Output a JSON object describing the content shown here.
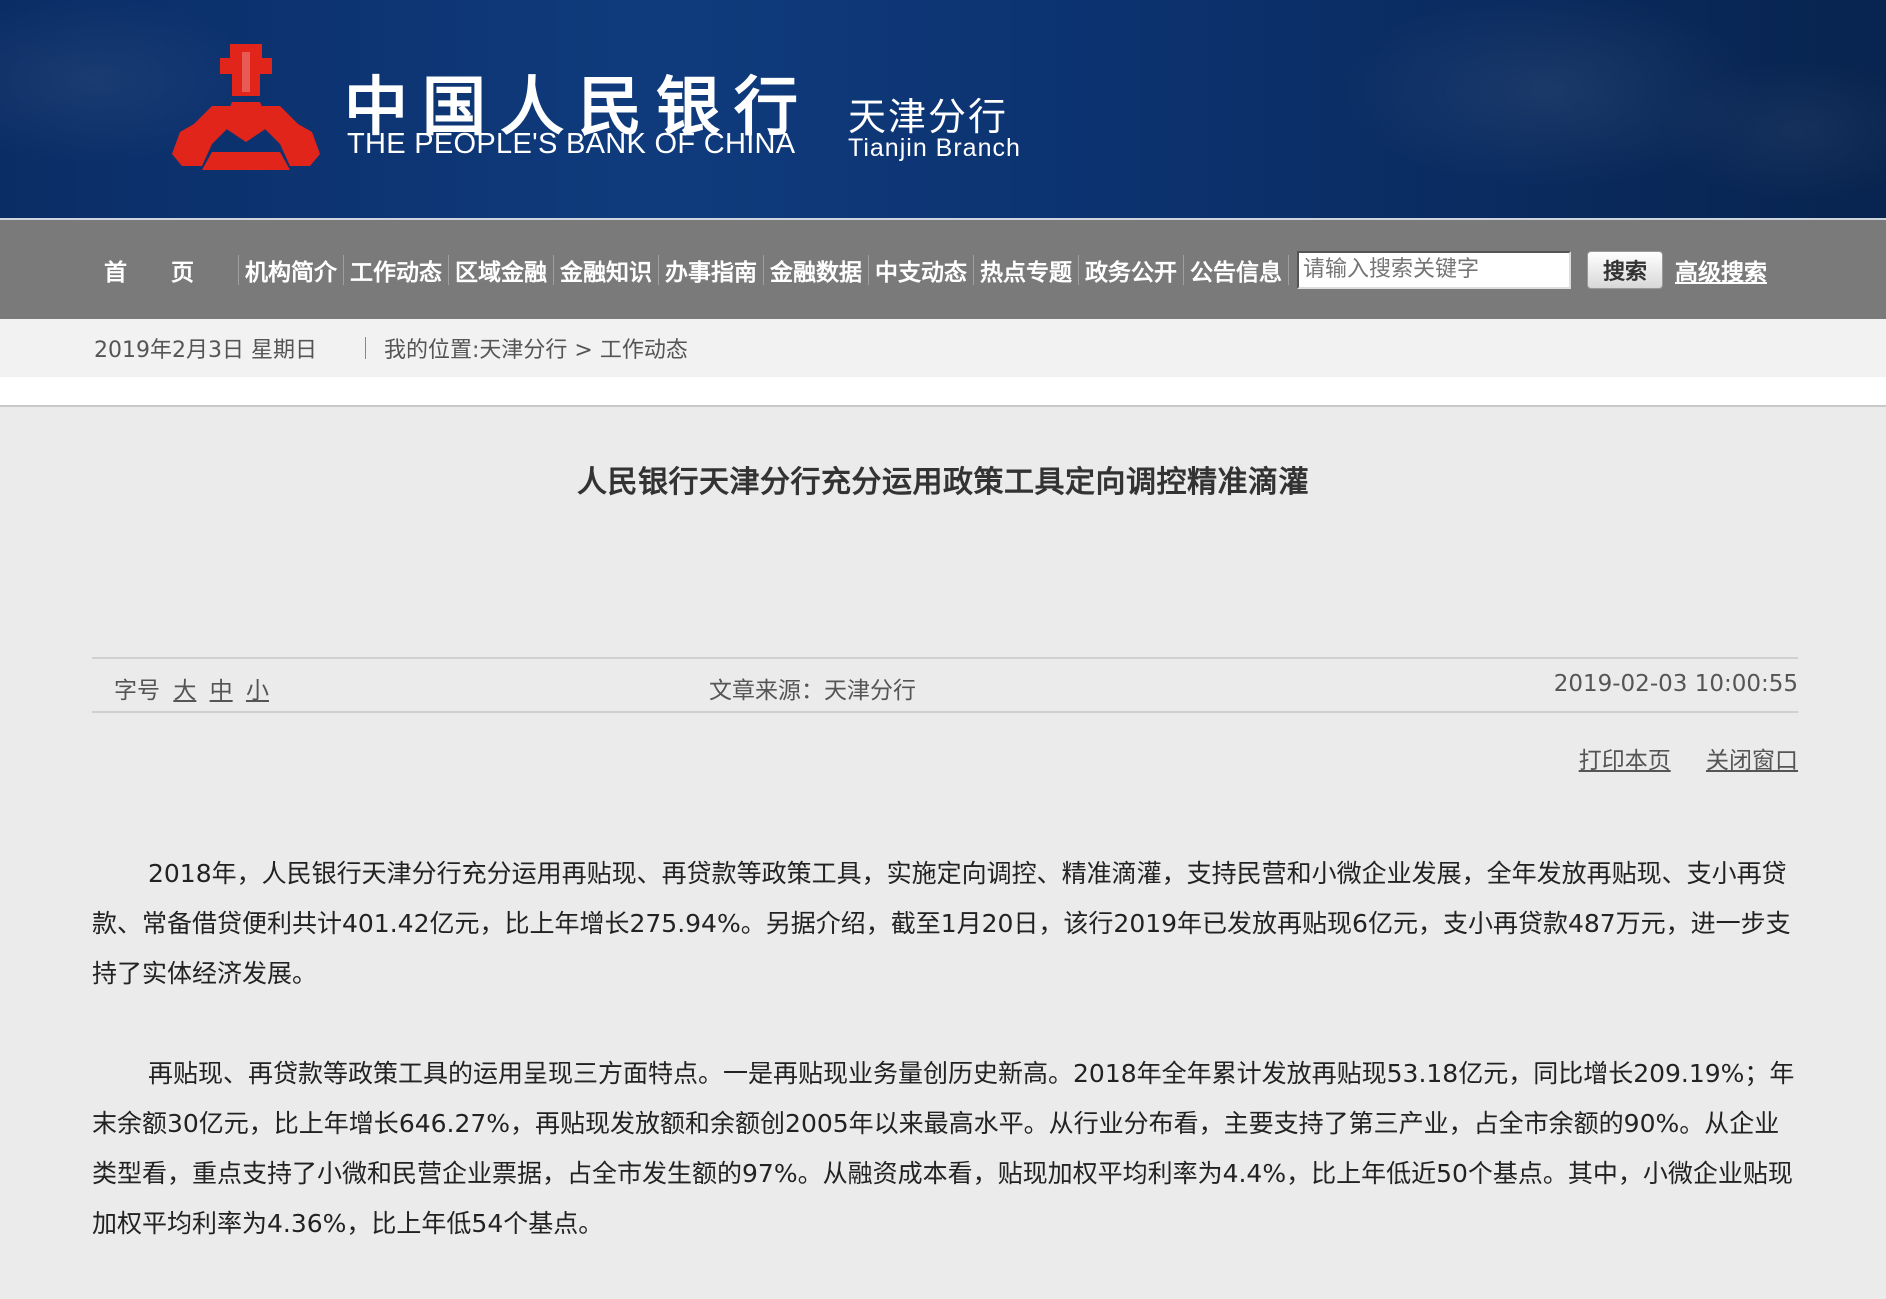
{
  "header": {
    "bank_name_cn": "中国人民银行",
    "bank_name_en": "THE PEOPLE'S BANK OF CHINA",
    "branch_cn": "天津分行",
    "branch_en": "Tianjin  Branch",
    "logo_icon": "pboc-emblem-icon",
    "colors": {
      "banner": "#0f3b7d",
      "logo": "#e1251b",
      "nav": "#7a7a7a"
    }
  },
  "nav": {
    "items": [
      "首页",
      "机构简介",
      "工作动态",
      "区域金融",
      "金融知识",
      "办事指南",
      "金融数据",
      "中支动态",
      "热点专题",
      "政务公开",
      "公告信息"
    ],
    "search_placeholder": "请输入搜索关键字",
    "search_button": "搜索",
    "advanced_search": "高级搜索"
  },
  "location": {
    "date": "2019年2月3日  星期日",
    "breadcrumb": "我的位置:天津分行 > 工作动态"
  },
  "article": {
    "title": "人民银行天津分行充分运用政策工具定向调控精准滴灌",
    "font_size_label": "字号",
    "font_size_options": [
      "大",
      "中",
      "小"
    ],
    "source": "文章来源：天津分行",
    "published": "2019-02-03 10:00:55",
    "print_label": "打印本页",
    "close_label": "关闭窗口",
    "paragraphs": [
      "2018年，人民银行天津分行充分运用再贴现、再贷款等政策工具，实施定向调控、精准滴灌，支持民营和小微企业发展，全年发放再贴现、支小再贷款、常备借贷便利共计401.42亿元，比上年增长275.94%。另据介绍，截至1月20日，该行2019年已发放再贴现6亿元，支小再贷款487万元，进一步支持了实体经济发展。",
      "再贴现、再贷款等政策工具的运用呈现三方面特点。一是再贴现业务量创历史新高。2018年全年累计发放再贴现53.18亿元，同比增长209.19%；年末余额30亿元，比上年增长646.27%，再贴现发放额和余额创2005年以来最高水平。从行业分布看，主要支持了第三产业，占全市余额的90%。从企业类型看，重点支持了小微和民营企业票据，占全市发生额的97%。从融资成本看，贴现加权平均利率为4.4%，比上年低近50个基点。其中，小微企业贴现加权平均利率为4.36%，比上年低54个基点。"
    ]
  }
}
